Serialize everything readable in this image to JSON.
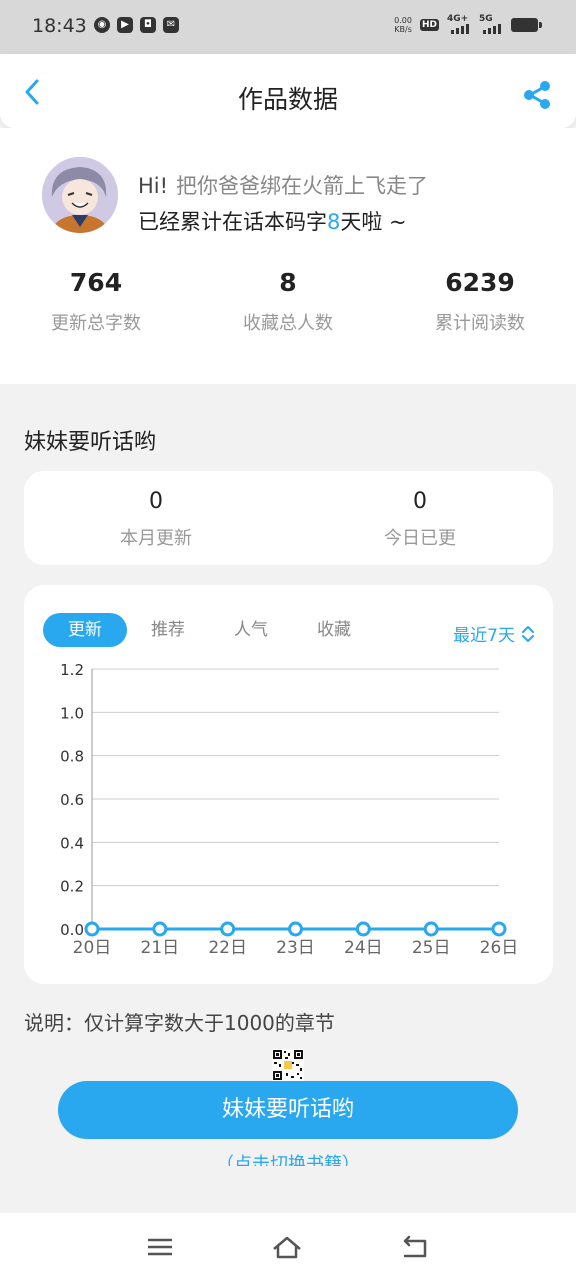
{
  "status_bar": {
    "time": "18:43",
    "speed_value": "0.00",
    "speed_unit": "KB/s",
    "hd_label": "HD",
    "network_1": "4G+",
    "network_2": "5G"
  },
  "header": {
    "title": "作品数据",
    "back_icon": "chevron-left-icon",
    "share_icon": "share-icon"
  },
  "profile": {
    "greeting_hi": "Hi!",
    "greeting_msg": "把你爸爸绑在火箭上飞走了",
    "days_prefix": "已经累计在话本码字",
    "days": "8",
    "days_suffix": "天啦 ~"
  },
  "stats": [
    {
      "value": "764",
      "label": "更新总字数"
    },
    {
      "value": "8",
      "label": "收藏总人数"
    },
    {
      "value": "6239",
      "label": "累计阅读数"
    }
  ],
  "book": {
    "title": "妹妹要听话哟"
  },
  "monthly": [
    {
      "value": "0",
      "label": "本月更新"
    },
    {
      "value": "0",
      "label": "今日已更"
    }
  ],
  "chart_tabs": [
    "更新",
    "推荐",
    "人气",
    "收藏"
  ],
  "active_tab": 0,
  "range_label": "最近7天",
  "accent_color": "#29a8f0",
  "chart_data": {
    "type": "line",
    "categories": [
      "20日",
      "21日",
      "22日",
      "23日",
      "24日",
      "25日",
      "26日"
    ],
    "series": [
      {
        "values": [
          0,
          0,
          0,
          0,
          0,
          0,
          0
        ]
      }
    ],
    "ylim": [
      0,
      1.2
    ],
    "yticks": [
      "0.0",
      "0.2",
      "0.4",
      "0.6",
      "0.8",
      "1.0",
      "1.2"
    ],
    "grid": true
  },
  "note": "说明：仅计算字数大于1000的章节",
  "main_button": "妹妹要听话哟",
  "switch_label": "（点击切换书籍）",
  "nav": {
    "menu_icon": "menu-icon",
    "home_icon": "home-icon",
    "back_icon": "back-icon"
  }
}
